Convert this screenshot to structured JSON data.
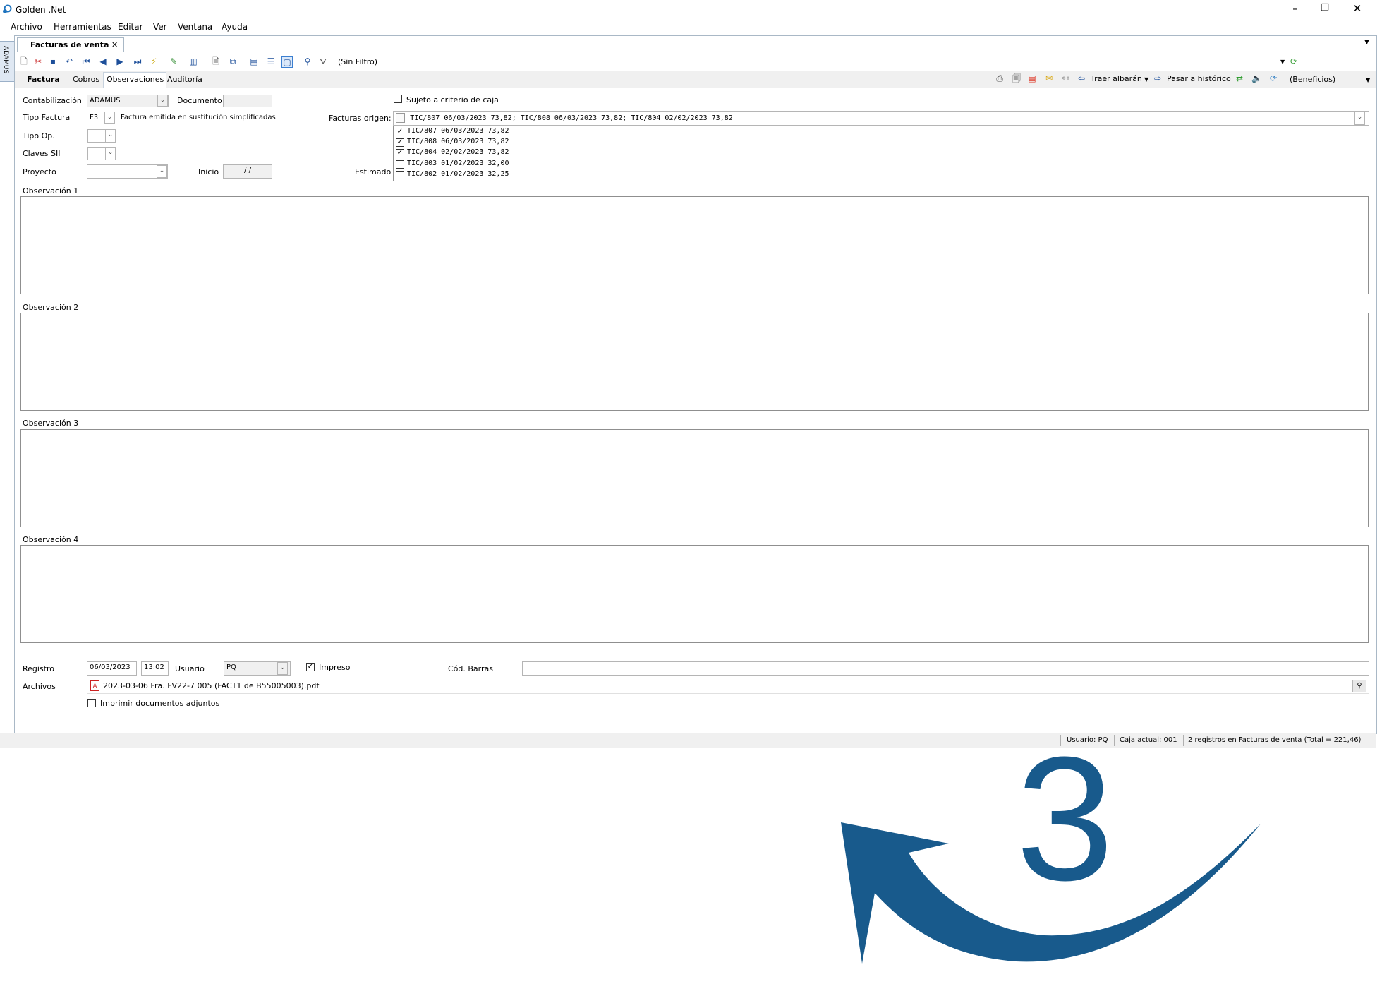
{
  "window": {
    "title": "Golden .Net",
    "controls": [
      "minimize",
      "restore",
      "close"
    ]
  },
  "menu": [
    "Archivo",
    "Herramientas",
    "Editar",
    "Ver",
    "Ventana",
    "Ayuda"
  ],
  "side_tab": "ADAMUS",
  "document_tab": {
    "label": "Facturas de venta",
    "close": "✕"
  },
  "toolbar": {
    "filter_label": "(Sin Filtro)"
  },
  "subtabs": [
    "Factura",
    "Cobros",
    "Observaciones",
    "Auditoría"
  ],
  "right_toolbar": {
    "traer_albaran": "Traer albarán",
    "pasar_historico": "Pasar a histórico",
    "beneficios": "(Beneficios)"
  },
  "form": {
    "contabilizacion": {
      "label": "Contabilización",
      "value": "ADAMUS"
    },
    "documento": {
      "label": "Documento",
      "value": ""
    },
    "tipo_factura": {
      "label": "Tipo Factura",
      "code": "F3",
      "description": "Factura emitida en sustitución simplificadas"
    },
    "tipo_op": {
      "label": "Tipo Op.",
      "value": ""
    },
    "claves_sii": {
      "label": "Claves SII",
      "value": ""
    },
    "proyecto": {
      "label": "Proyecto",
      "value": ""
    },
    "inicio": {
      "label": "Inicio",
      "value": " /  /"
    },
    "estimado": {
      "label": "Estimado"
    },
    "sujeto_criterio_caja": {
      "label": "Sujeto a criterio de caja",
      "checked": false
    },
    "facturas_origen": {
      "label": "Facturas origen:",
      "summary": "TIC/807 06/03/2023 73,82; TIC/808 06/03/2023 73,82; TIC/804 02/02/2023 73,82",
      "items": [
        {
          "text": "TIC/807 06/03/2023 73,82",
          "checked": true
        },
        {
          "text": "TIC/808 06/03/2023 73,82",
          "checked": true
        },
        {
          "text": "TIC/804 02/02/2023 73,82",
          "checked": true
        },
        {
          "text": "TIC/803 01/02/2023 32,00",
          "checked": false
        },
        {
          "text": "TIC/802 01/02/2023 32,25",
          "checked": false
        }
      ]
    },
    "observaciones": [
      "Observación 1",
      "Observación 2",
      "Observación 3",
      "Observación 4"
    ],
    "registro": {
      "label": "Registro",
      "date": "06/03/2023",
      "time": "13:02"
    },
    "usuario": {
      "label": "Usuario",
      "value": "PQ"
    },
    "impreso": {
      "label": "Impreso",
      "checked": true
    },
    "cod_barras": {
      "label": "Cód. Barras",
      "value": ""
    },
    "archivos": {
      "label": "Archivos",
      "file": "2023-03-06 Fra. FV22-7 005 (FACT1 de B55005003).pdf"
    },
    "imprimir_adjuntos": {
      "label": "Imprimir documentos adjuntos",
      "checked": false
    }
  },
  "status": {
    "usuario": "Usuario: PQ",
    "caja": "Caja actual: 001",
    "registros": "2 registros en Facturas de venta (Total = 221,46)"
  },
  "overlay": {
    "number": "3",
    "color": "#185a8c"
  }
}
